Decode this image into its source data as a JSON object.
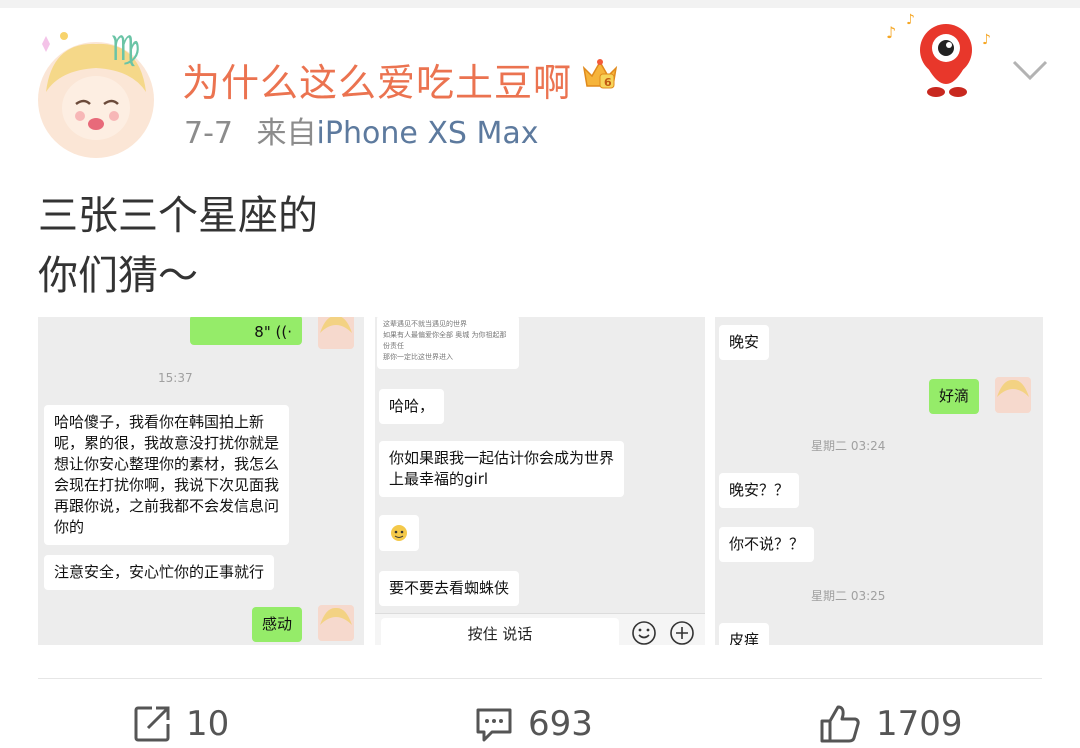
{
  "post": {
    "username": "为什么这么爱吃土豆啊",
    "date": "7-7",
    "source_prefix": "来自",
    "device": "iPhone XS Max",
    "text_line1": "三张三个星座的",
    "text_line2": "你们猜～"
  },
  "panel1": {
    "top_bubble": "8\"",
    "time": "15:37",
    "msg1_lines": [
      "哈哈傻子，我看你在韩国拍上新",
      "呢，累的很，我故意没打扰你就是",
      "想让你安心整理你的素材，我怎么",
      "会现在打扰你啊，我说下次见面我",
      "再跟你说，之前我都不会发信息问",
      "你的"
    ],
    "msg2": "注意安全，安心忙你的正事就行",
    "reply": "感动"
  },
  "panel2": {
    "quoted_lines": [
      "这辈遇见不就当遇见的世界",
      "如果有人最偏爱你全部 奥城 为你祖起那份责任",
      "那你一定比这世界进入"
    ],
    "msg1": "哈哈，",
    "msg2_lines": [
      "你如果跟我一起估计你会成为世界",
      "上最幸福的girl"
    ],
    "msg4": "要不要去看蜘蛛侠",
    "voice_label": "按住 说话"
  },
  "panel3": {
    "msg1": "晚安",
    "reply": "好滴",
    "time1": "星期二 03:24",
    "msg2": "晚安？？",
    "msg3": "你不说？？",
    "time2": "星期二 03:25",
    "msg4": "皮痒"
  },
  "actions": {
    "forward_count": "10",
    "comment_count": "693",
    "like_count": "1709"
  },
  "colors": {
    "username": "#eb7350",
    "device_link": "#5d7a9e",
    "wechat_green": "#95ec69",
    "chat_bg": "#ededed"
  },
  "icons": [
    "virgo-avatar",
    "vip-crown-icon",
    "mascot-sticker",
    "chevron-down-icon",
    "forward-icon",
    "comment-icon",
    "like-icon",
    "voice-icon",
    "emoji-icon",
    "plus-icon"
  ]
}
